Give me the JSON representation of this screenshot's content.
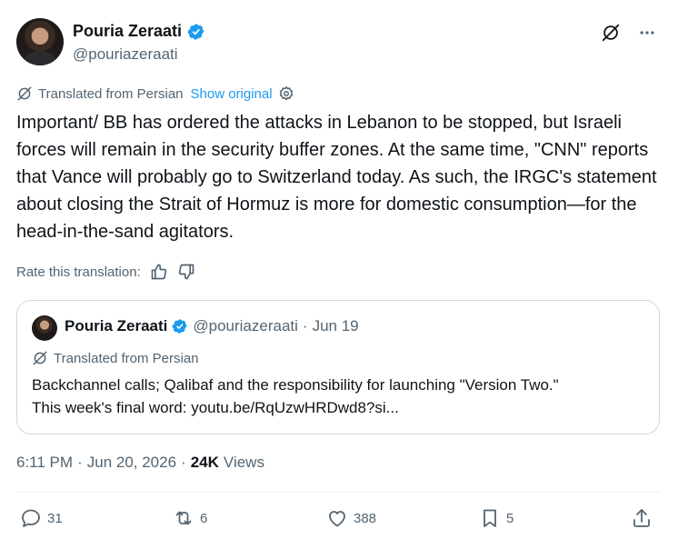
{
  "author": {
    "name": "Pouria Zeraati",
    "handle": "@pouriazeraati",
    "verified": true
  },
  "header_icons": [
    "grok-icon",
    "more-icon"
  ],
  "translation": {
    "label": "Translated from Persian",
    "show_original": "Show original"
  },
  "body": "Important/ BB has ordered the attacks in Lebanon to be stopped, but Israeli forces will remain in the security buffer zones. At the same time, \"CNN\" reports that Vance will probably go to Switzerland today. As such, the IRGC's statement about closing the Strait of Hormuz is more for domestic consumption—for the head-in-the-sand agitators.",
  "rate": {
    "label": "Rate this translation:"
  },
  "quote": {
    "name": "Pouria Zeraati",
    "handle": "@pouriazeraati",
    "separator": "·",
    "date": "Jun 19",
    "translation_label": "Translated from Persian",
    "text_line1": "Backchannel calls; Qalibaf and the responsibility for launching \"Version Two.\"",
    "text_line2": "This week's final word: youtu.be/RqUzwHRDwd8?si..."
  },
  "meta": {
    "time": "6:11 PM",
    "dot": "·",
    "date": "Jun 20, 2026",
    "views_count": "24K",
    "views_label": "Views"
  },
  "actions": {
    "replies": "31",
    "reposts": "6",
    "likes": "388",
    "bookmarks": "5"
  },
  "colors": {
    "link": "#1d9bf0",
    "muted": "#536471",
    "text": "#0f1419",
    "border": "#cfd9de"
  }
}
